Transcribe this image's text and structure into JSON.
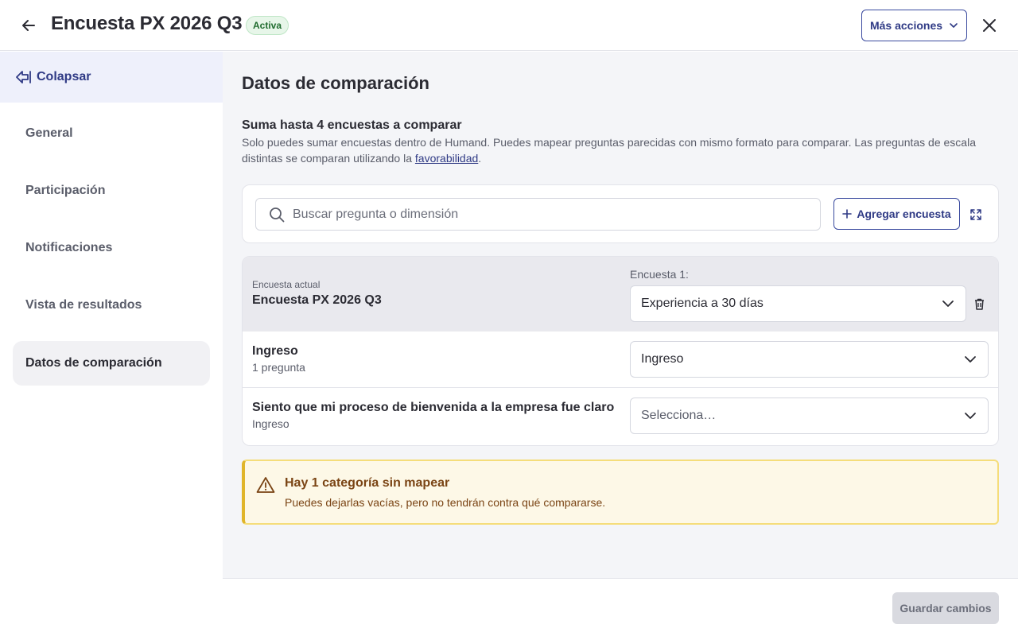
{
  "header": {
    "title": "Encuesta PX 2026 Q3",
    "status_badge": "Activa",
    "more_actions_label": "Más acciones"
  },
  "sidebar": {
    "collapse_label": "Colapsar",
    "items": [
      {
        "label": "General",
        "active": false
      },
      {
        "label": "Participación",
        "active": false
      },
      {
        "label": "Notificaciones",
        "active": false
      },
      {
        "label": "Vista de resultados",
        "active": false
      },
      {
        "label": "Datos de comparación",
        "active": true
      }
    ]
  },
  "main": {
    "page_title": "Datos de comparación",
    "subtitle": "Suma hasta 4 encuestas a comparar",
    "description": "Solo puedes sumar encuestas dentro de Humand. Puedes mapear preguntas parecidas con mismo formato para comparar. Las preguntas de escala distintas se comparan utilizando la ",
    "description_link": "favorabilidad",
    "description_end": ".",
    "search": {
      "placeholder": "Buscar pregunta o dimensión",
      "value": ""
    },
    "add_survey_label": "Agregar encuesta",
    "table": {
      "current_label": "Encuesta actual",
      "current_name": "Encuesta PX 2026 Q3",
      "compare_label": "Encuesta 1:",
      "compare_value": "Experiencia a 30 días",
      "rows": [
        {
          "title": "Ingreso",
          "subtitle": "1 pregunta",
          "select_value": "Ingreso",
          "is_placeholder": false
        },
        {
          "title": "Siento que mi proceso de bienvenida a la empresa fue claro",
          "subtitle": "Ingreso",
          "select_value": "Selecciona…",
          "is_placeholder": true
        }
      ]
    },
    "alert": {
      "title": "Hay 1 categoría sin mapear",
      "text": "Puedes dejarlas vacías, pero no tendrán contra qué compararse."
    }
  },
  "footer": {
    "save_label": "Guardar cambios"
  },
  "colors": {
    "brand": "#2f3a85",
    "active_badge_bg": "#e7f6e9",
    "warning_border": "#f5dd7a",
    "warning_text": "#7a4414"
  },
  "icons": {
    "back": "arrow-left-icon",
    "close": "close-icon",
    "chevron": "chevron-down-icon",
    "collapse": "collapse-icon",
    "search": "search-icon",
    "plus": "plus-icon",
    "expand": "expand-icon",
    "trash": "trash-icon",
    "warning": "warning-icon"
  }
}
